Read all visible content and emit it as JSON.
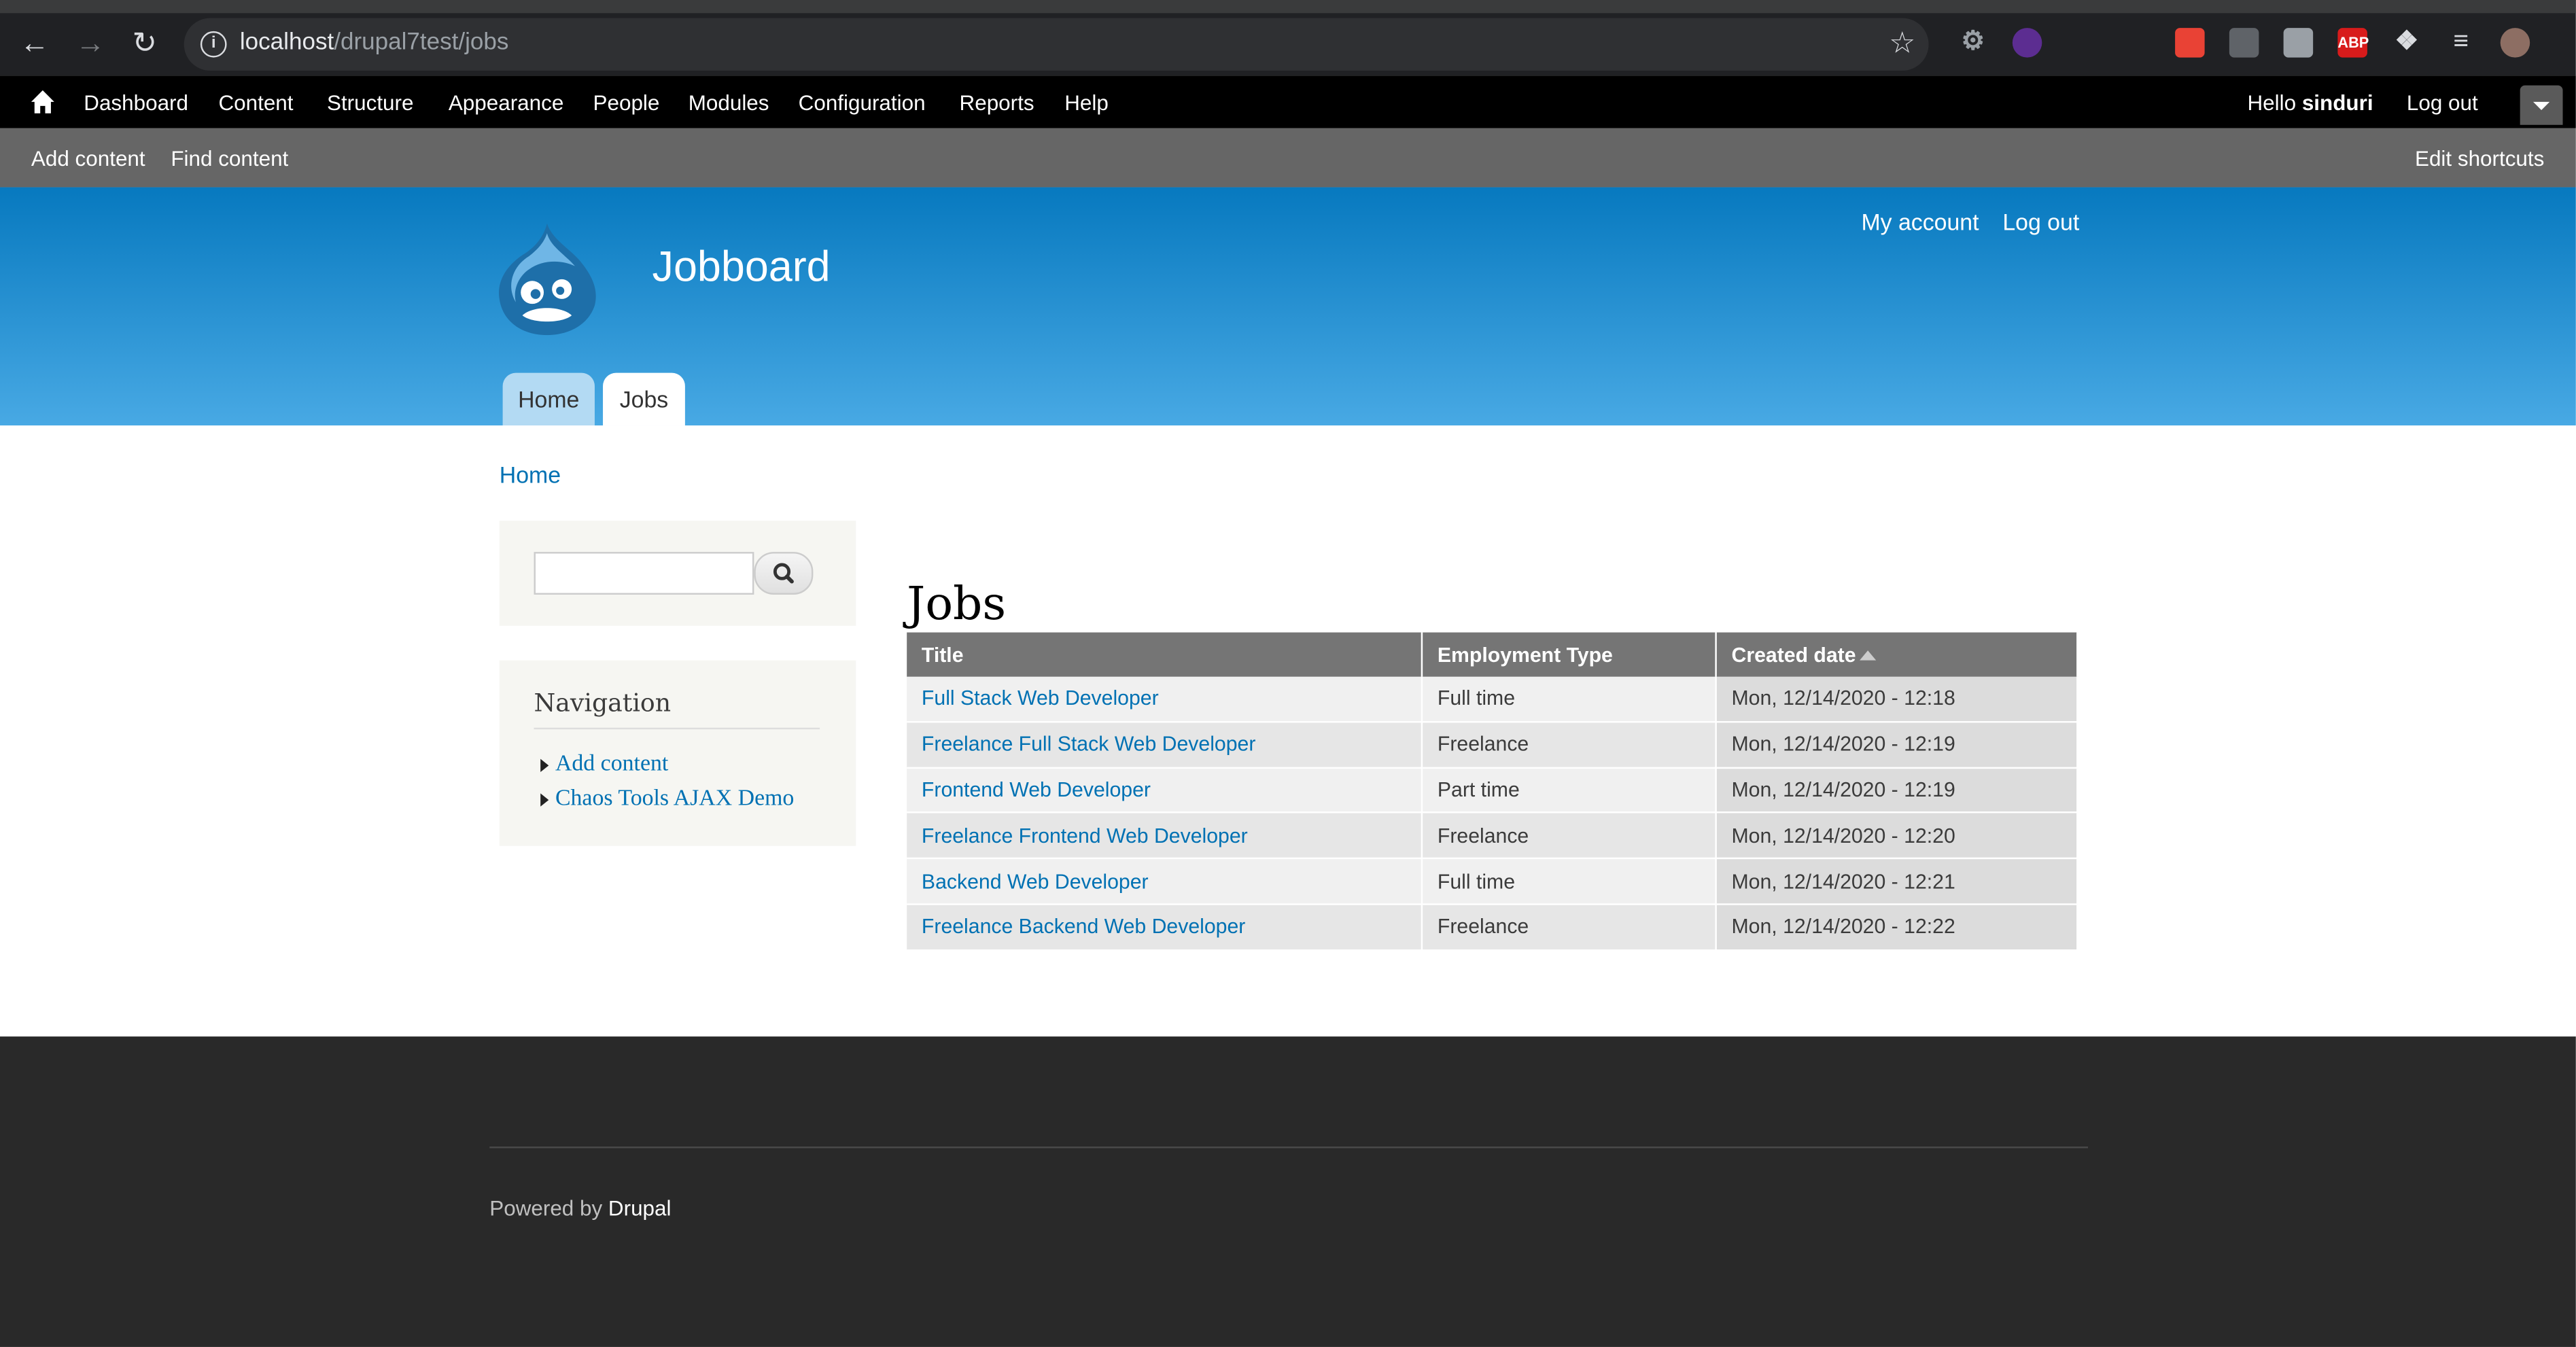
{
  "browser": {
    "url_host": "localhost",
    "url_path": "/drupal7test/jobs",
    "extensions": [
      {
        "name": "gear-icon",
        "color": "#9aa0a6"
      },
      {
        "name": "tor-icon",
        "color": "#5c2d91"
      },
      {
        "name": "color-picker-icon",
        "color": "#e94235"
      },
      {
        "name": "screenshot-icon",
        "color": "#5f6368"
      },
      {
        "name": "font-icon",
        "color": "#9aa0a6"
      },
      {
        "name": "adblock-icon",
        "color": "#d81b1b",
        "label": "ABP"
      },
      {
        "name": "puzzle-icon",
        "color": "#dadce0"
      },
      {
        "name": "reading-list-icon",
        "color": "#dadce0"
      },
      {
        "name": "profile-avatar-icon",
        "color": "#8d6e63"
      }
    ]
  },
  "toolbar": {
    "items": [
      "Dashboard",
      "Content",
      "Structure",
      "Appearance",
      "People",
      "Modules",
      "Configuration",
      "Reports",
      "Help"
    ],
    "hello_prefix": "Hello ",
    "username": "sinduri",
    "logout": "Log out"
  },
  "shortcuts": {
    "add_content": "Add content",
    "find_content": "Find content",
    "edit_shortcuts": "Edit shortcuts"
  },
  "header": {
    "site_name": "Jobboard",
    "my_account": "My account",
    "log_out": "Log out",
    "tabs": [
      "Home",
      "Jobs"
    ],
    "active_tab": "Jobs"
  },
  "breadcrumb": "Home",
  "sidebar": {
    "search_placeholder": "",
    "nav_title": "Navigation",
    "nav_links": [
      "Add content",
      "Chaos Tools AJAX Demo"
    ]
  },
  "main": {
    "title": "Jobs",
    "columns": [
      "Title",
      "Employment Type",
      "Created date"
    ],
    "sorted_column": "Created date",
    "rows": [
      {
        "title": "Full Stack Web Developer",
        "type": "Full time",
        "created": "Mon, 12/14/2020 - 12:18"
      },
      {
        "title": "Freelance Full Stack Web Developer",
        "type": "Freelance",
        "created": "Mon, 12/14/2020 - 12:19"
      },
      {
        "title": "Frontend Web Developer",
        "type": "Part time",
        "created": "Mon, 12/14/2020 - 12:19"
      },
      {
        "title": "Freelance Frontend Web Developer",
        "type": "Freelance",
        "created": "Mon, 12/14/2020 - 12:20"
      },
      {
        "title": "Backend Web Developer",
        "type": "Full time",
        "created": "Mon, 12/14/2020 - 12:21"
      },
      {
        "title": "Freelance Backend Web Developer",
        "type": "Freelance",
        "created": "Mon, 12/14/2020 - 12:22"
      }
    ]
  },
  "footer": {
    "powered_by": "Powered by ",
    "drupal": "Drupal"
  },
  "colors": {
    "link": "#0071b3",
    "header_top": "#0779bf",
    "header_bottom": "#48a9e4",
    "footer_bg": "#292929"
  }
}
